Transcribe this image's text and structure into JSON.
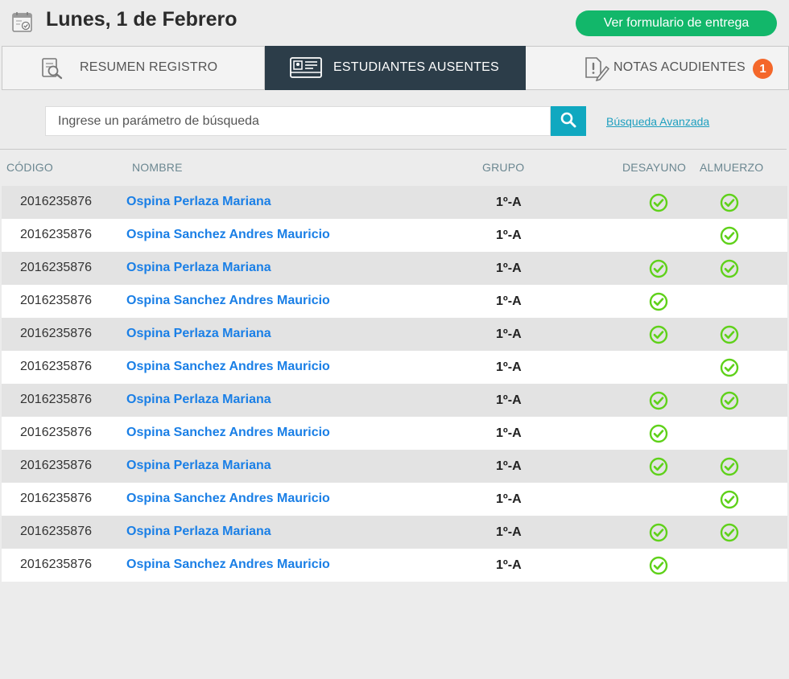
{
  "header": {
    "title": "Lunes, 1 de Febrero",
    "primary_button": "Ver formulario de entrega"
  },
  "tabs": [
    {
      "label": "RESUMEN REGISTRO",
      "icon": "search-document-icon",
      "active": false
    },
    {
      "label": "ESTUDIANTES AUSENTES",
      "icon": "id-card-icon",
      "active": true
    },
    {
      "label": "NOTAS ACUDIENTES",
      "icon": "note-alert-icon",
      "active": false,
      "badge": "1"
    }
  ],
  "search": {
    "placeholder": "Ingrese un parámetro de búsqueda",
    "advanced_link": "Búsqueda Avanzada"
  },
  "table": {
    "columns": {
      "codigo": "CÓDIGO",
      "nombre": "NOMBRE",
      "grupo": "GRUPO",
      "desayuno": "DESAYUNO",
      "almuerzo": "ALMUERZO"
    },
    "rows": [
      {
        "code": "2016235876",
        "name": "Ospina Perlaza Mariana",
        "group": "1º-A",
        "desayuno": true,
        "almuerzo": true
      },
      {
        "code": "2016235876",
        "name": "Ospina Sanchez Andres Mauricio",
        "group": "1º-A",
        "desayuno": false,
        "almuerzo": true
      },
      {
        "code": "2016235876",
        "name": "Ospina Perlaza Mariana",
        "group": "1º-A",
        "desayuno": true,
        "almuerzo": true
      },
      {
        "code": "2016235876",
        "name": "Ospina Sanchez Andres Mauricio",
        "group": "1º-A",
        "desayuno": true,
        "almuerzo": false
      },
      {
        "code": "2016235876",
        "name": "Ospina Perlaza Mariana",
        "group": "1º-A",
        "desayuno": true,
        "almuerzo": true
      },
      {
        "code": "2016235876",
        "name": "Ospina Sanchez Andres Mauricio",
        "group": "1º-A",
        "desayuno": false,
        "almuerzo": true
      },
      {
        "code": "2016235876",
        "name": "Ospina Perlaza Mariana",
        "group": "1º-A",
        "desayuno": true,
        "almuerzo": true
      },
      {
        "code": "2016235876",
        "name": "Ospina Sanchez Andres Mauricio",
        "group": "1º-A",
        "desayuno": true,
        "almuerzo": false
      },
      {
        "code": "2016235876",
        "name": "Ospina Perlaza Mariana",
        "group": "1º-A",
        "desayuno": true,
        "almuerzo": true
      },
      {
        "code": "2016235876",
        "name": "Ospina Sanchez Andres Mauricio",
        "group": "1º-A",
        "desayuno": false,
        "almuerzo": true
      },
      {
        "code": "2016235876",
        "name": "Ospina Perlaza Mariana",
        "group": "1º-A",
        "desayuno": true,
        "almuerzo": true
      },
      {
        "code": "2016235876",
        "name": "Ospina Sanchez Andres Mauricio",
        "group": "1º-A",
        "desayuno": true,
        "almuerzo": false
      }
    ]
  },
  "colors": {
    "primary_green": "#12b76a",
    "tab_active": "#2c3d49",
    "badge": "#f4672a",
    "search_button": "#10a8c0",
    "name_link": "#1a7fe6",
    "check": "#5fd11a"
  }
}
